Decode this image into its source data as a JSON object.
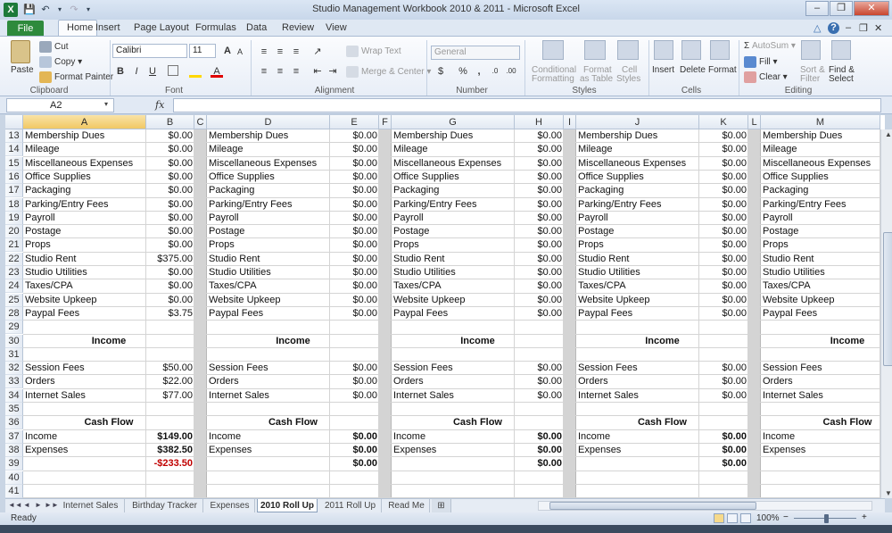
{
  "window": {
    "title": "Studio Management Workbook 2010 & 2011  -  Microsoft Excel",
    "app_icon_letter": "X",
    "controls": {
      "minimize": "–",
      "restore": "❐",
      "close": "✕"
    },
    "doc_controls": {
      "minimize": "–",
      "restore": "❐",
      "close": "✕"
    }
  },
  "quick_access": {
    "save": "💾",
    "undo": "↶",
    "redo": "↷",
    "customize": "▾"
  },
  "ribbon_tabs": [
    "File",
    "Home",
    "Insert",
    "Page Layout",
    "Formulas",
    "Data",
    "Review",
    "View"
  ],
  "ribbon_right": {
    "minimize": "△",
    "help": "?"
  },
  "ribbon": {
    "clipboard": {
      "paste": "Paste",
      "cut": "Cut",
      "copy": "Copy",
      "format_painter": "Format Painter",
      "label": "Clipboard"
    },
    "font": {
      "name": "Calibri",
      "size": "11",
      "bold": "B",
      "italic": "I",
      "underline": "U",
      "grow": "A",
      "shrink": "A",
      "label": "Font"
    },
    "alignment": {
      "wrap": "Wrap Text",
      "merge": "Merge & Center",
      "label": "Alignment"
    },
    "number": {
      "format": "General",
      "currency": "$",
      "percent": "%",
      "comma": ",",
      "label": "Number"
    },
    "styles": {
      "conditional": "Conditional",
      "conditional2": "Formatting",
      "format_table": "Format",
      "format_table2": "as Table",
      "cell_styles": "Cell",
      "cell_styles2": "Styles",
      "label": "Styles"
    },
    "cells": {
      "insert": "Insert",
      "delete": "Delete",
      "format": "Format",
      "label": "Cells"
    },
    "editing": {
      "autosum": "AutoSum",
      "fill": "Fill",
      "clear": "Clear",
      "sort": "Sort &",
      "sort2": "Filter",
      "find": "Find &",
      "find2": "Select",
      "label": "Editing"
    }
  },
  "formula_bar": {
    "name_box": "A2",
    "fx": "fx",
    "content": ""
  },
  "columns": [
    "A",
    "B",
    "C",
    "D",
    "E",
    "F",
    "G",
    "H",
    "I",
    "J",
    "K",
    "L",
    "M"
  ],
  "rows": [
    {
      "num": "13",
      "label": "Membership Dues",
      "vals": [
        "$0.00",
        "$0.00",
        "$0.00",
        "$0.00"
      ]
    },
    {
      "num": "14",
      "label": "Mileage",
      "vals": [
        "$0.00",
        "$0.00",
        "$0.00",
        "$0.00"
      ]
    },
    {
      "num": "15",
      "label": "Miscellaneous Expenses",
      "vals": [
        "$0.00",
        "$0.00",
        "$0.00",
        "$0.00"
      ]
    },
    {
      "num": "16",
      "label": "Office Supplies",
      "vals": [
        "$0.00",
        "$0.00",
        "$0.00",
        "$0.00"
      ]
    },
    {
      "num": "17",
      "label": "Packaging",
      "vals": [
        "$0.00",
        "$0.00",
        "$0.00",
        "$0.00"
      ]
    },
    {
      "num": "18",
      "label": "Parking/Entry Fees",
      "vals": [
        "$0.00",
        "$0.00",
        "$0.00",
        "$0.00"
      ]
    },
    {
      "num": "19",
      "label": "Payroll",
      "vals": [
        "$0.00",
        "$0.00",
        "$0.00",
        "$0.00"
      ]
    },
    {
      "num": "20",
      "label": "Postage",
      "vals": [
        "$0.00",
        "$0.00",
        "$0.00",
        "$0.00"
      ]
    },
    {
      "num": "21",
      "label": "Props",
      "vals": [
        "$0.00",
        "$0.00",
        "$0.00",
        "$0.00"
      ]
    },
    {
      "num": "22",
      "label": "Studio Rent",
      "vals": [
        "$375.00",
        "$0.00",
        "$0.00",
        "$0.00"
      ]
    },
    {
      "num": "23",
      "label": "Studio Utilities",
      "vals": [
        "$0.00",
        "$0.00",
        "$0.00",
        "$0.00"
      ]
    },
    {
      "num": "24",
      "label": "Taxes/CPA",
      "vals": [
        "$0.00",
        "$0.00",
        "$0.00",
        "$0.00"
      ]
    },
    {
      "num": "25",
      "label": "Website Upkeep",
      "vals": [
        "$0.00",
        "$0.00",
        "$0.00",
        "$0.00"
      ]
    },
    {
      "num": "28",
      "label": "Paypal Fees",
      "vals": [
        "$3.75",
        "$0.00",
        "$0.00",
        "$0.00"
      ]
    },
    {
      "num": "29",
      "label": "",
      "vals": [
        "",
        "",
        "",
        ""
      ]
    },
    {
      "num": "30",
      "label": "Income",
      "header": true,
      "vals": [
        "",
        "",
        "",
        ""
      ]
    },
    {
      "num": "31",
      "label": "",
      "vals": [
        "",
        "",
        "",
        ""
      ]
    },
    {
      "num": "32",
      "label": "Session Fees",
      "vals": [
        "$50.00",
        "$0.00",
        "$0.00",
        "$0.00"
      ]
    },
    {
      "num": "33",
      "label": "Orders",
      "vals": [
        "$22.00",
        "$0.00",
        "$0.00",
        "$0.00"
      ]
    },
    {
      "num": "34",
      "label": "Internet Sales",
      "vals": [
        "$77.00",
        "$0.00",
        "$0.00",
        "$0.00"
      ]
    },
    {
      "num": "35",
      "label": "",
      "vals": [
        "",
        "",
        "",
        ""
      ]
    },
    {
      "num": "36",
      "label": "Cash Flow",
      "header": true,
      "vals": [
        "",
        "",
        "",
        ""
      ]
    },
    {
      "num": "37",
      "label": "Income",
      "bold_vals": true,
      "vals": [
        "$149.00",
        "$0.00",
        "$0.00",
        "$0.00"
      ]
    },
    {
      "num": "38",
      "label": "Expenses",
      "bold_vals": true,
      "vals": [
        "$382.50",
        "$0.00",
        "$0.00",
        "$0.00"
      ]
    },
    {
      "num": "39",
      "label": "",
      "bold_vals": true,
      "net": true,
      "vals": [
        "-$233.50",
        "$0.00",
        "$0.00",
        "$0.00"
      ]
    },
    {
      "num": "40",
      "label": "",
      "vals": [
        "",
        "",
        "",
        ""
      ]
    },
    {
      "num": "41",
      "label": "",
      "vals": [
        "",
        "",
        "",
        ""
      ]
    }
  ],
  "sheet_tabs": [
    "Internet Sales",
    "Birthday Tracker",
    "Expenses",
    "2010 Roll Up",
    "2011 Roll Up",
    "Read Me"
  ],
  "active_sheet": "2010 Roll Up",
  "sheet_nav": [
    "◄◄",
    "◄",
    "►",
    "►►"
  ],
  "status": {
    "text": "Ready",
    "zoom": "100%",
    "zoom_out": "−",
    "zoom_in": "+"
  },
  "colors": {
    "file_tab": "#2e8a3c",
    "selected_header": "#f1c864",
    "negative": "#c00000"
  }
}
